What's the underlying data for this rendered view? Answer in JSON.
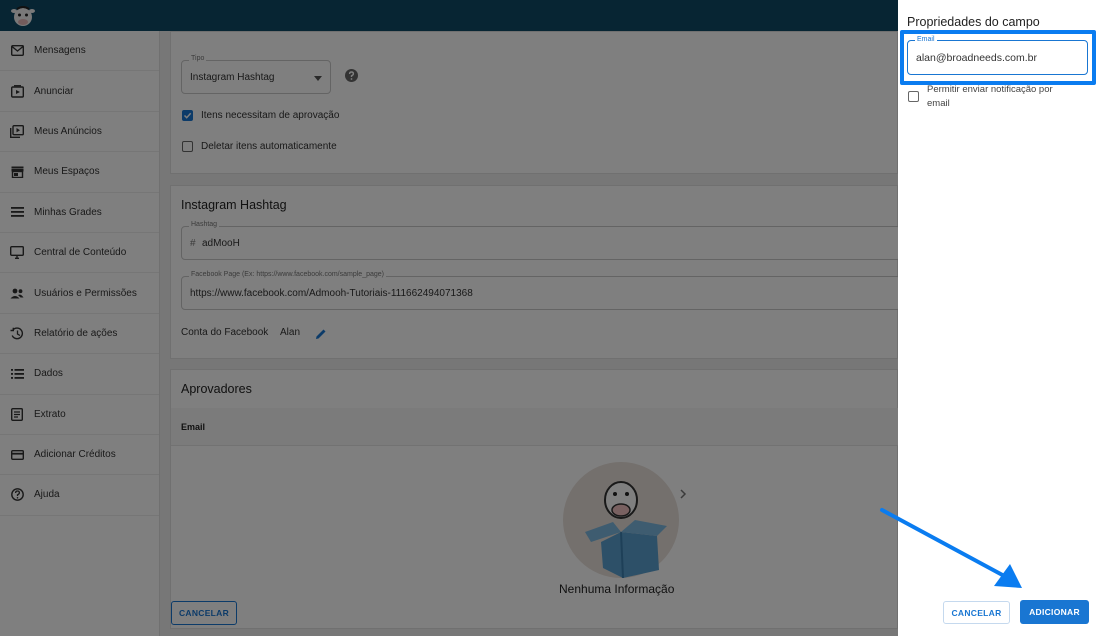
{
  "sidebar": {
    "items": [
      {
        "label": "Mensagens",
        "icon": "mail-icon"
      },
      {
        "label": "Anunciar",
        "icon": "play-box-icon"
      },
      {
        "label": "Meus Anúncios",
        "icon": "play-stack-icon"
      },
      {
        "label": "Meus Espaços",
        "icon": "store-icon"
      },
      {
        "label": "Minhas Grades",
        "icon": "lines-icon"
      },
      {
        "label": "Central de Conteúdo",
        "icon": "monitor-icon"
      },
      {
        "label": "Usuários e Permissões",
        "icon": "users-icon"
      },
      {
        "label": "Relatório de ações",
        "icon": "history-icon"
      },
      {
        "label": "Dados",
        "icon": "list-icon"
      },
      {
        "label": "Extrato",
        "icon": "receipt-icon"
      },
      {
        "label": "Adicionar Créditos",
        "icon": "card-icon"
      },
      {
        "label": "Ajuda",
        "icon": "help-icon"
      }
    ]
  },
  "form": {
    "tipo_label": "Tipo",
    "tipo_value": "Instagram Hashtag",
    "approval_label": "Itens necessitam de aprovação",
    "approval_checked": true,
    "delete_label": "Deletar itens automaticamente",
    "delete_checked": false
  },
  "instagram": {
    "title": "Instagram Hashtag",
    "hashtag_label": "Hashtag",
    "hashtag_prefix": "#",
    "hashtag_value": "adMooH",
    "fb_page_label": "Facebook Page (Ex: https://www.facebook.com/sample_page)",
    "fb_page_value": "https://www.facebook.com/Admooh-Tutoriais-111662494071368",
    "fb_account_label": "Conta do Facebook",
    "fb_account_value": "Alan"
  },
  "approvers": {
    "title": "Aprovadores",
    "column_email": "Email",
    "empty_text": "Nenhuma Informação"
  },
  "main_actions": {
    "cancel_label": "CANCELAR"
  },
  "panel": {
    "title": "Propriedades do campo",
    "email_label": "Email",
    "email_value": "alan@broadneeds.com.br",
    "notify_label": "Permitir enviar notificação por email",
    "notify_checked": false,
    "cancel_label": "CANCELAR",
    "add_label": "ADICIONAR"
  },
  "colors": {
    "topbar": "#0f4a66",
    "primary": "#1976d2",
    "highlight": "#0a7cf0"
  }
}
